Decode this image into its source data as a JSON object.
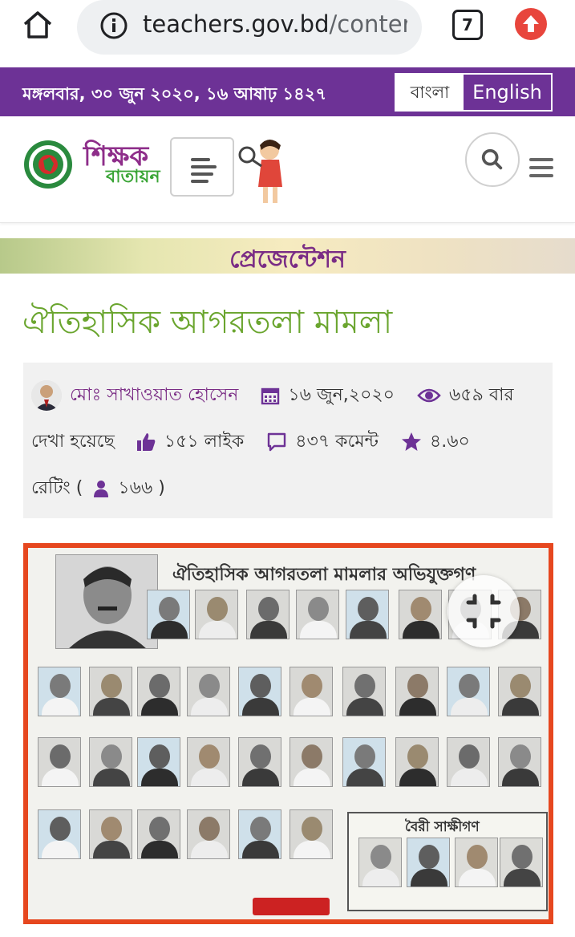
{
  "browser": {
    "url_domain": "teachers.gov.bd",
    "url_path": "/conter",
    "tab_count": "7"
  },
  "topbar": {
    "date": "মঙ্গলবার, ৩০ জুন ২০২০, ১৬ আষাঢ় ১৪২৭",
    "lang_bn": "বাংলা",
    "lang_en": "English"
  },
  "header": {
    "brand_top": "শিক্ষক",
    "brand_bottom": "বাতায়ন"
  },
  "section": {
    "label": "প্রেজেন্টেশন"
  },
  "article": {
    "title": "ঐতিহাসিক আগরতলা মামলা",
    "author": "মোঃ সাখাওয়াত হোসেন",
    "date": "১৬ জুন,২০২০",
    "views_count": "৬৫৯ বার",
    "views_suffix": "দেখা হয়েছে",
    "likes": "১৫১ লাইক",
    "comments": "৪৩৭ কমেন্ট",
    "rating": "৪.৬০",
    "rating_label": "রেটিং (",
    "raters": "১৬৬ )"
  },
  "poster": {
    "title": "ঐতিহাসিক আগরতলা মামলার অভিযুক্তগণ",
    "witness_title": "বৈরী সাক্ষীগণ"
  },
  "colors": {
    "purple": "#6d3296",
    "green_title": "#6aa52e",
    "poster_border": "#e6471f"
  }
}
